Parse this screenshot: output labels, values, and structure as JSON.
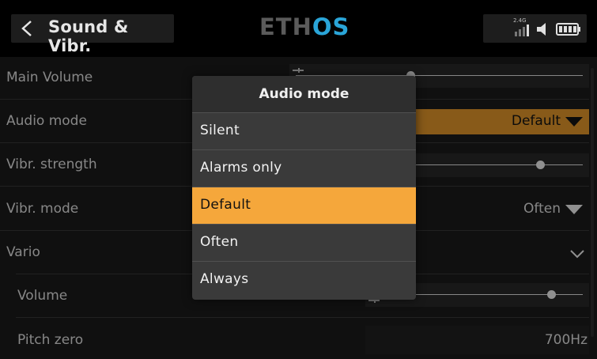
{
  "header": {
    "title": "Sound & Vibr.",
    "logo_main": "ETH",
    "logo_accent": "OS",
    "rf_label": "2.4G"
  },
  "settings": {
    "main_volume": {
      "label": "Main Volume",
      "level": 0.4
    },
    "audio_mode": {
      "label": "Audio mode",
      "value": "Default"
    },
    "vibr_strength": {
      "label": "Vibr. strength",
      "level": 0.85
    },
    "vibr_mode": {
      "label": "Vibr. mode",
      "value": "Often"
    },
    "vario": {
      "label": "Vario"
    },
    "vario_volume": {
      "label": "Volume",
      "level": 0.85
    },
    "pitch_zero": {
      "label": "Pitch zero",
      "value": "700Hz"
    }
  },
  "popup": {
    "title": "Audio mode",
    "options": [
      "Silent",
      "Alarms only",
      "Default",
      "Often",
      "Always"
    ],
    "selected": "Default"
  },
  "colors": {
    "accent": "#f5a73b",
    "logo_accent": "#2aa5d8"
  },
  "icons": [
    "back-icon",
    "signal-icon",
    "speaker-icon",
    "battery-icon",
    "dropdown-arrow-icon",
    "chevron-down-icon",
    "minus-icon"
  ]
}
